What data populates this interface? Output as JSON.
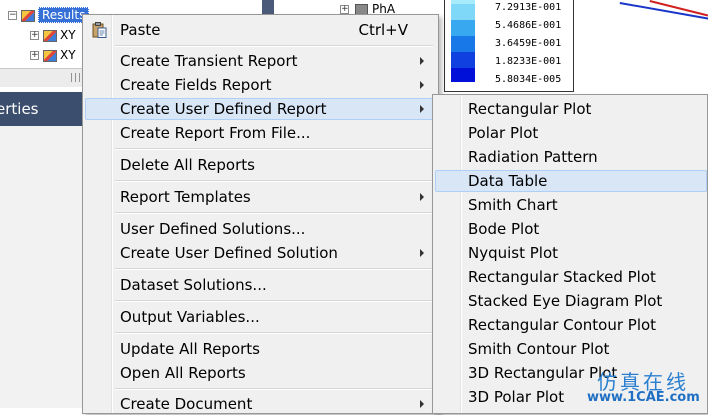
{
  "tree": {
    "items": [
      {
        "label": "Results",
        "expander": "−"
      },
      {
        "label": "XY",
        "expander": "+"
      },
      {
        "label": "XY",
        "expander": "+"
      }
    ]
  },
  "properties_panel": {
    "title": "erties"
  },
  "middle_tree": {
    "label": "PhA",
    "expander": "+"
  },
  "legend": {
    "values": [
      "7.2913E-001",
      "5.4686E-001",
      "3.6459E-001",
      "1.8233E-001",
      "5.8034E-005"
    ],
    "colors": [
      "#7fd8f8",
      "#38a8f0",
      "#1878e8",
      "#1040e0",
      "#0010d8"
    ]
  },
  "context_menu": {
    "paste": {
      "label": "Paste",
      "shortcut": "Ctrl+V"
    },
    "create_transient_report": "Create Transient Report",
    "create_fields_report": "Create Fields Report",
    "create_user_defined_report": "Create User Defined Report",
    "create_report_from_file": "Create Report From File...",
    "delete_all_reports": "Delete All Reports",
    "report_templates": "Report Templates",
    "user_defined_solutions": "User Defined Solutions...",
    "create_user_defined_solution": "Create User Defined Solution",
    "dataset_solutions": "Dataset Solutions...",
    "output_variables": "Output Variables...",
    "update_all_reports": "Update All Reports",
    "open_all_reports": "Open All Reports",
    "create_document": "Create Document"
  },
  "submenu": {
    "items": [
      "Rectangular Plot",
      "Polar Plot",
      "Radiation Pattern",
      "Data Table",
      "Smith Chart",
      "Bode Plot",
      "Nyquist Plot",
      "Rectangular Stacked Plot",
      "Stacked Eye Diagram Plot",
      "Rectangular Contour Plot",
      "Smith Contour Plot",
      "3D Rectangular Plot",
      "3D Polar Plot"
    ],
    "highlighted": "Data Table"
  },
  "watermark": {
    "text": "1CAE.COM"
  },
  "site_badge": {
    "cn": "仿真在线",
    "url": "www.1CAE.com"
  },
  "colors": {
    "menu_bg": "#f0f0f0",
    "highlight": "#d9e6f6",
    "props_header": "#3b4e6d",
    "selection": "#3470d6"
  }
}
